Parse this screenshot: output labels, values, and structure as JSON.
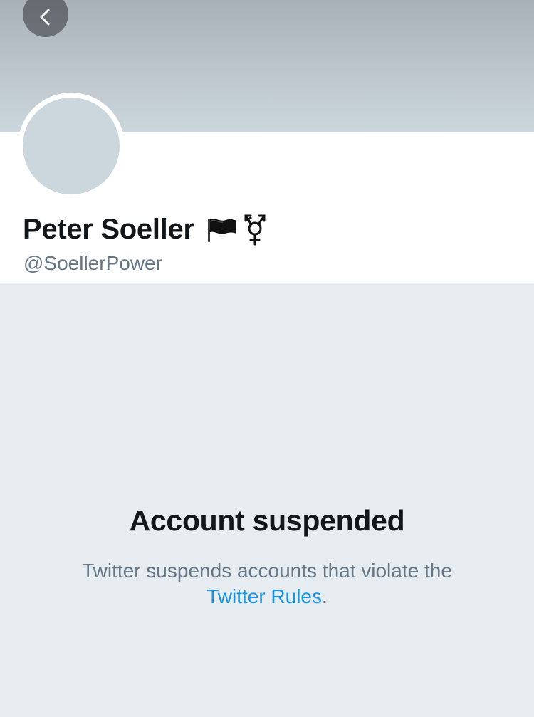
{
  "profile": {
    "display_name": "Peter Soeller",
    "handle": "@SoellerPower",
    "name_emoji": [
      "black-flag-icon",
      "transgender-symbol-icon"
    ]
  },
  "suspension": {
    "title": "Account suspended",
    "message_before": "Twitter suspends accounts that violate the",
    "link_text": "Twitter Rules",
    "message_after": "."
  },
  "colors": {
    "link": "#1b95e0",
    "secondary_text": "#657786",
    "primary_text": "#14171a",
    "background": "#e6ecf0",
    "avatar_placeholder": "#ccd6dd"
  }
}
